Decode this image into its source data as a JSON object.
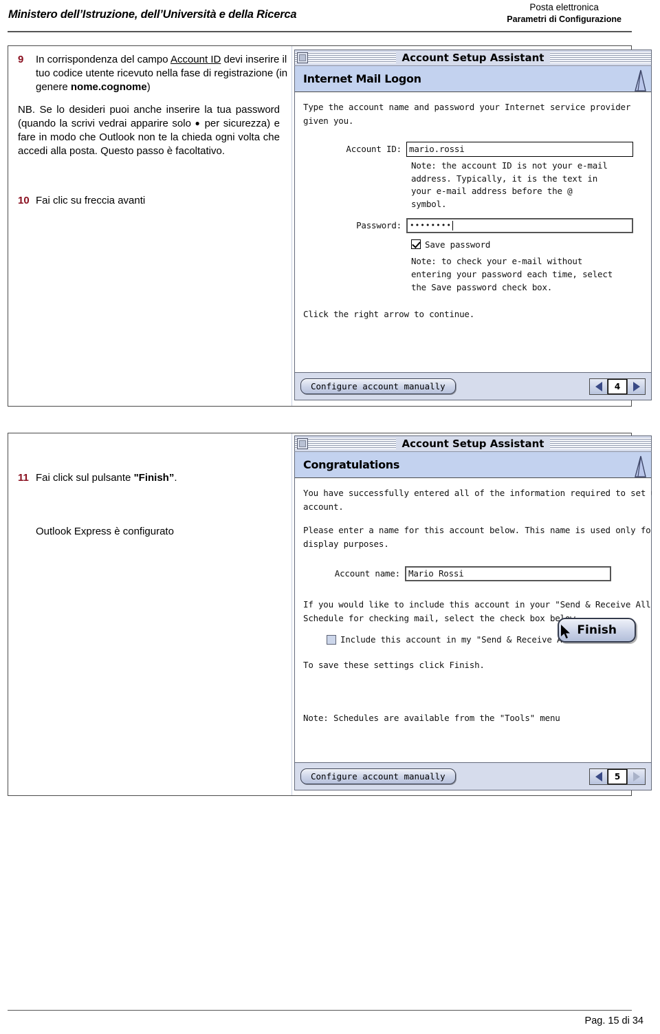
{
  "header": {
    "ministry": "Ministero dell’Istruzione, dell’Università e della Ricerca",
    "right_line1": "Posta elettronica",
    "right_line2": "Parametri di Configurazione"
  },
  "footer": {
    "page": "Pag. 15 di 34"
  },
  "section1": {
    "step9": {
      "number": "9",
      "line1_a": "In corrispondenza del campo ",
      "line1_underlined": "Account ID",
      "line1_b": " devi inserire il tuo codice utente ricevuto nella fase di registrazione (in genere ",
      "line1_bold": "nome.cognome",
      "line1_c": ")"
    },
    "nb": {
      "prefix": "NB. Se lo desideri puoi anche inserire la tua password (quando la scrivi vedrai apparire solo ",
      "bullet": "●",
      "suffix": " per sicurezza) e fare in modo che Outlook non te la chieda ogni volta che accedi alla posta. Questo passo è facoltativo."
    },
    "step10": {
      "number": "10",
      "text": "Fai clic su freccia avanti"
    }
  },
  "section2": {
    "step11": {
      "number": "11",
      "text_a": "Fai click sul pulsante ",
      "text_bold": "\"Finish”",
      "text_b": "."
    },
    "closing": "Outlook Express è configurato"
  },
  "dialog1": {
    "window_title": "Account Setup Assistant",
    "banner_title": "Internet Mail Logon",
    "intro_l1": "Type the account name and password your Internet service provider",
    "intro_l2": "given you.",
    "account_label": "Account ID:",
    "account_value": "mario.rossi",
    "account_note_l1": "Note: the account ID is not your e-mail",
    "account_note_l2": "address. Typically, it is the text in",
    "account_note_l3": "your e-mail address before the @",
    "account_note_l4": "symbol.",
    "password_label": "Password:",
    "password_value": "••••••••",
    "save_password_label": "Save password",
    "save_password_checked": true,
    "password_note_l1": "Note: to check your e-mail without",
    "password_note_l2": "entering your password each time, select",
    "password_note_l3": "the Save password check box.",
    "continue_hint": "Click the right arrow to continue.",
    "manual_button": "Configure account manually",
    "page_number": "4",
    "back_icon": "left-triangle-icon",
    "next_icon": "right-triangle-icon"
  },
  "dialog2": {
    "window_title": "Account Setup Assistant",
    "banner_title": "Congratulations",
    "intro_l1": "You have successfully entered all of the information required to set u",
    "intro_l2": "account.",
    "intro2_l1": "Please enter a name for this account below. This name is used only fo",
    "intro2_l2": "display purposes.",
    "account_name_label": "Account name:",
    "account_name_value": "Mario Rossi",
    "schedule_l1": "If you would like to include this account in your \"Send & Receive All'",
    "schedule_l2": "Schedule for checking mail, select the check box below.",
    "include_label": "Include this account in my \"Send & Receive All\" schedule",
    "include_checked": false,
    "save_hint": "To save these settings click Finish.",
    "finish_button": "Finish",
    "tools_note": "Note: Schedules are available from the \"Tools\" menu",
    "manual_button": "Configure account manually",
    "page_number": "5",
    "back_icon": "left-triangle-icon",
    "next_icon": "right-triangle-icon-disabled"
  },
  "colors": {
    "step_number": "#8a1020",
    "banner": "#c3d2ef",
    "titlebar": "#d6dcec"
  }
}
